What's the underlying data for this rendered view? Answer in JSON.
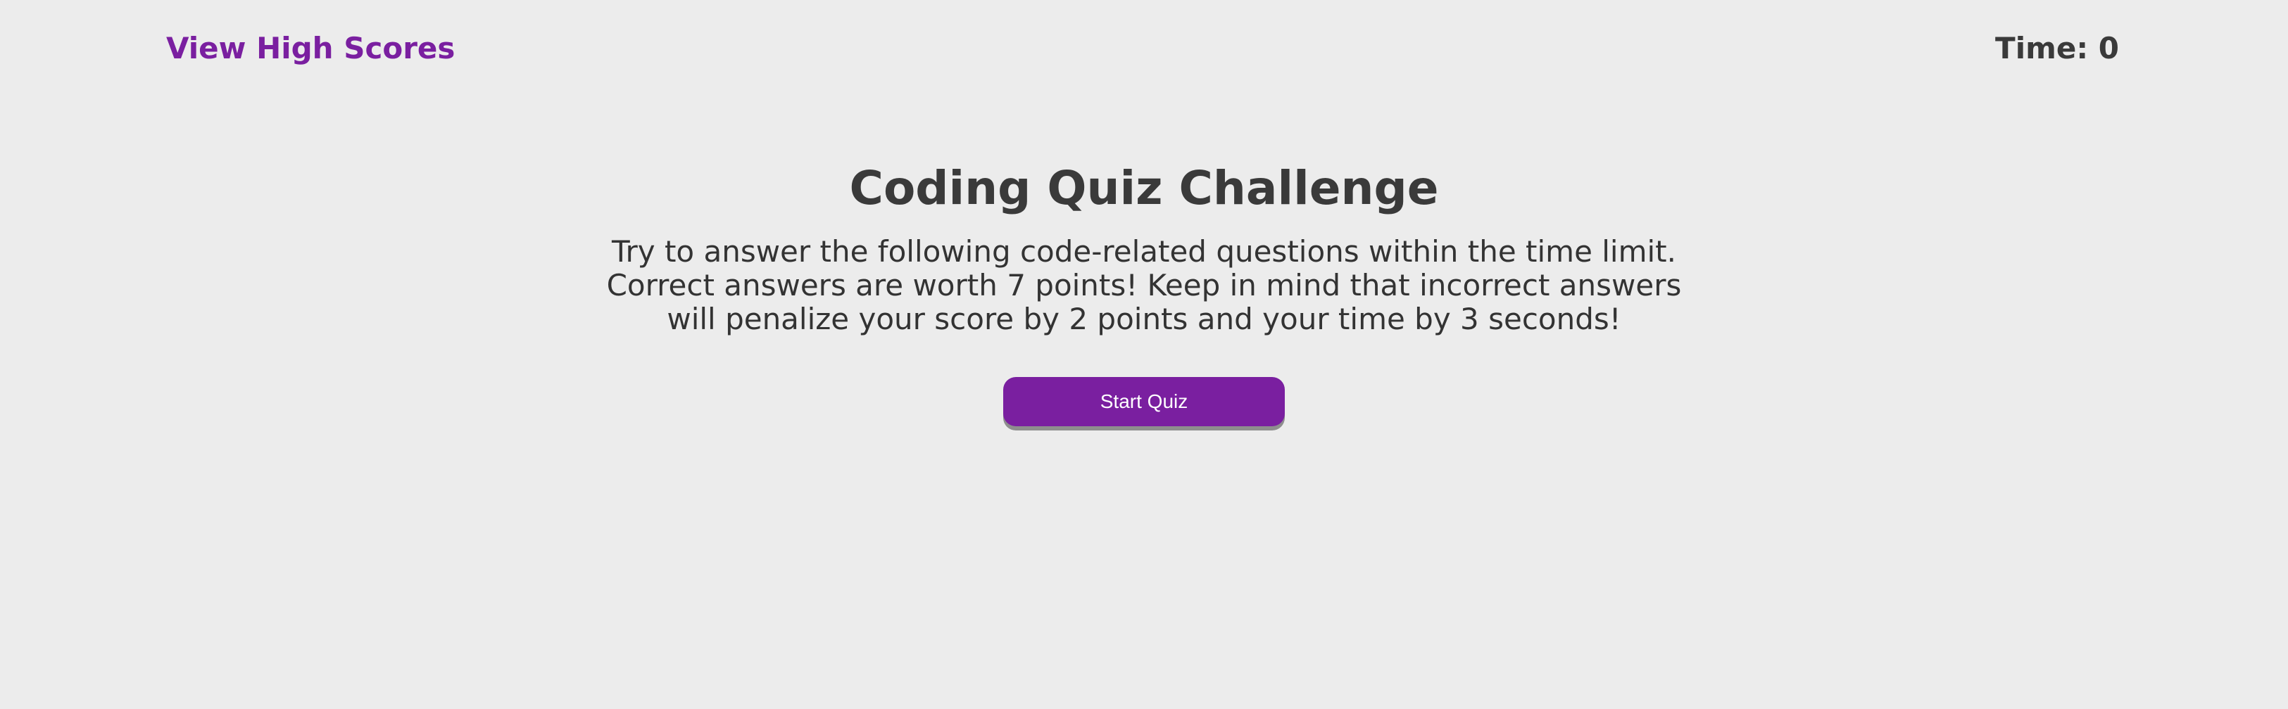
{
  "header": {
    "high_scores_label": "View High Scores",
    "timer_label": "Time:",
    "timer_value": "0"
  },
  "intro": {
    "title": "Coding Quiz Challenge",
    "description": "Try to answer the following code-related questions within the time limit. Correct answers are worth 7 points! Keep in mind that incorrect answers will penalize your score by 2 points and your time by 3 seconds!",
    "start_button_label": "Start Quiz"
  },
  "colors": {
    "accent": "#7a1fa0",
    "background": "#ececec",
    "text": "#3a3a3a"
  }
}
